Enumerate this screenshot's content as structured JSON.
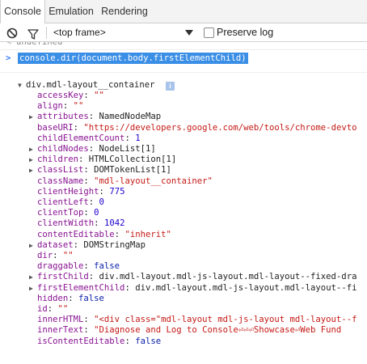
{
  "tabs": [
    {
      "label": "Console",
      "active": true
    },
    {
      "label": "Emulation",
      "active": false
    },
    {
      "label": "Rendering",
      "active": false
    }
  ],
  "toolbar": {
    "frame_label": "<top frame>",
    "preserve_log_label": "Preserve log",
    "preserve_log_checked": false,
    "icons": [
      "clear-console-icon",
      "filter-icon",
      "dropdown-arrow-icon"
    ]
  },
  "console": {
    "previous_result": "undefined",
    "command": "console.dir(document.body.firstElementChild)",
    "root_object": "div.mdl-layout__container",
    "info_badge": "i",
    "properties": [
      {
        "expandable": false,
        "key": "accessKey",
        "value": "\"\"",
        "type": "str"
      },
      {
        "expandable": false,
        "key": "align",
        "value": "\"\"",
        "type": "str"
      },
      {
        "expandable": true,
        "key": "attributes",
        "value": "NamedNodeMap",
        "type": "obj"
      },
      {
        "expandable": false,
        "key": "baseURI",
        "value": "\"https://developers.google.com/web/tools/chrome-devto",
        "type": "str"
      },
      {
        "expandable": false,
        "key": "childElementCount",
        "value": "1",
        "type": "num"
      },
      {
        "expandable": true,
        "key": "childNodes",
        "value": "NodeList[1]",
        "type": "obj"
      },
      {
        "expandable": true,
        "key": "children",
        "value": "HTMLCollection[1]",
        "type": "obj"
      },
      {
        "expandable": true,
        "key": "classList",
        "value": "DOMTokenList[1]",
        "type": "obj"
      },
      {
        "expandable": false,
        "key": "className",
        "value": "\"mdl-layout__container\"",
        "type": "str"
      },
      {
        "expandable": false,
        "key": "clientHeight",
        "value": "775",
        "type": "num"
      },
      {
        "expandable": false,
        "key": "clientLeft",
        "value": "0",
        "type": "num"
      },
      {
        "expandable": false,
        "key": "clientTop",
        "value": "0",
        "type": "num"
      },
      {
        "expandable": false,
        "key": "clientWidth",
        "value": "1042",
        "type": "num"
      },
      {
        "expandable": false,
        "key": "contentEditable",
        "value": "\"inherit\"",
        "type": "str"
      },
      {
        "expandable": true,
        "key": "dataset",
        "value": "DOMStringMap",
        "type": "obj"
      },
      {
        "expandable": false,
        "key": "dir",
        "value": "\"\"",
        "type": "str"
      },
      {
        "expandable": false,
        "key": "draggable",
        "value": "false",
        "type": "bool"
      },
      {
        "expandable": true,
        "key": "firstChild",
        "value": "div.mdl-layout.mdl-js-layout.mdl-layout--fixed-dra",
        "type": "obj"
      },
      {
        "expandable": true,
        "key": "firstElementChild",
        "value": "div.mdl-layout.mdl-js-layout.mdl-layout--fi",
        "type": "obj"
      },
      {
        "expandable": false,
        "key": "hidden",
        "value": "false",
        "type": "bool"
      },
      {
        "expandable": false,
        "key": "id",
        "value": "\"\"",
        "type": "str"
      },
      {
        "expandable": false,
        "key": "innerHTML",
        "value": "\"<div class=\"mdl-layout mdl-js-layout mdl-layout--f",
        "type": "str"
      },
      {
        "expandable": false,
        "key": "innerText",
        "value": "\"Diagnose and Log to Console⏎⏎⏎Showcase⏎Web Fund",
        "type": "str"
      },
      {
        "expandable": false,
        "key": "isContentEditable",
        "value": "false",
        "type": "bool"
      }
    ]
  }
}
